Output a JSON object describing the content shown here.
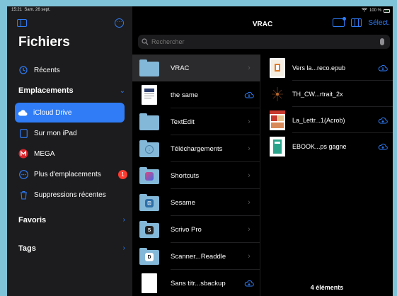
{
  "status": {
    "time": "15:21",
    "date": "Sam. 26 sept.",
    "battery": "100 %"
  },
  "sidebar": {
    "title": "Fichiers",
    "recents": "Récents",
    "locations_header": "Emplacements",
    "locations": [
      {
        "label": "iCloud Drive",
        "selected": true
      },
      {
        "label": "Sur mon iPad"
      },
      {
        "label": "MEGA"
      },
      {
        "label": "Plus d'emplacements",
        "badge": "1"
      },
      {
        "label": "Suppressions récentes"
      }
    ],
    "favorites_header": "Favoris",
    "tags_header": "Tags"
  },
  "nav": {
    "title": "VRAC",
    "select": "Sélect."
  },
  "search": {
    "placeholder": "Rechercher"
  },
  "column1": [
    {
      "label": "VRAC",
      "kind": "folder",
      "selected": true
    },
    {
      "label": "the same",
      "kind": "doc",
      "cloud": true
    },
    {
      "label": "TextEdit",
      "kind": "folder"
    },
    {
      "label": "Téléchargements",
      "kind": "folder-download"
    },
    {
      "label": "Shortcuts",
      "kind": "folder-shortcuts"
    },
    {
      "label": "Sesame",
      "kind": "folder-sesame"
    },
    {
      "label": "Scrivo Pro",
      "kind": "folder-scrivo"
    },
    {
      "label": "Scanner...Readdle",
      "kind": "folder-scanner"
    },
    {
      "label": "Sans titr...sbackup",
      "kind": "doc-blank",
      "cloud": true
    }
  ],
  "column2": [
    {
      "label": "Vers la...reco.epub",
      "cloud": true
    },
    {
      "label": "TH_CW...rtrait_2x",
      "cloud": false
    },
    {
      "label": "La_Lettr...1(Acrob)",
      "cloud": true
    },
    {
      "label": "EBOOK...ps gagne",
      "cloud": true
    }
  ],
  "footer": {
    "count": "4 éléments"
  },
  "colors": {
    "accent": "#2f7cf6",
    "folder": "#84b8d8",
    "badge": "#ff3b30",
    "mega": "#d9272e"
  }
}
